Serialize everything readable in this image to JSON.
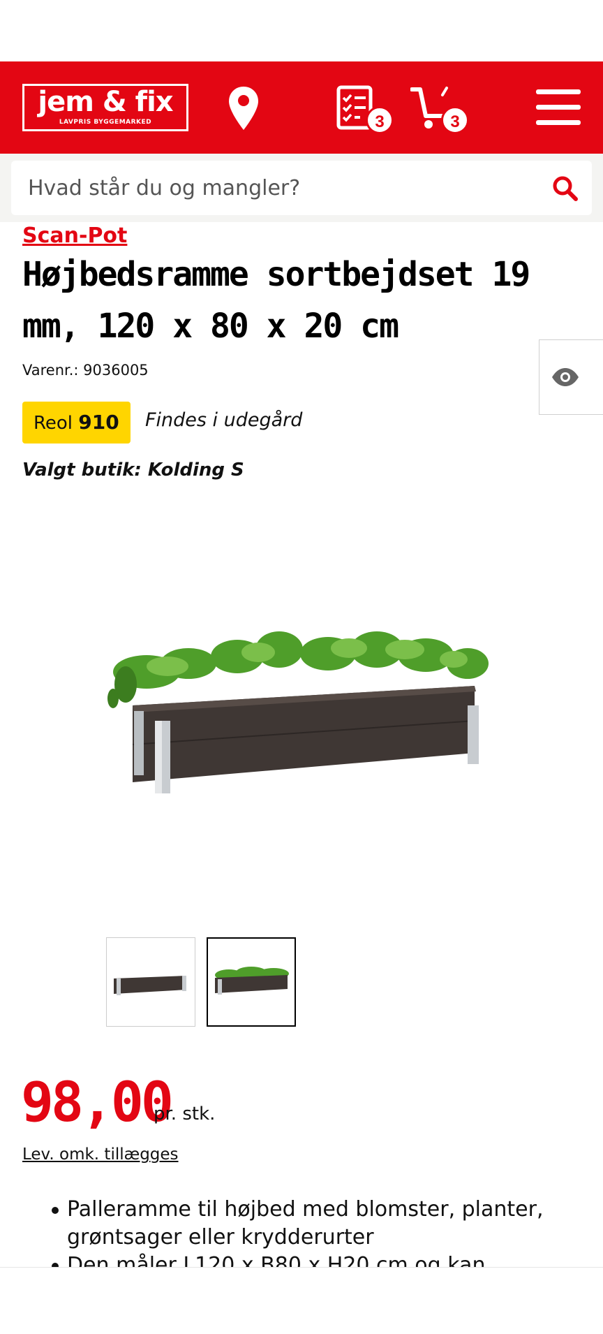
{
  "header": {
    "logo_main": "jem & fix",
    "logo_sub": "LAVPRIS BYGGEMARKED",
    "shopping_list_count": "3",
    "cart_count": "3",
    "brand_color": "#e30613"
  },
  "search": {
    "placeholder": "Hvad står du og mangler?"
  },
  "product": {
    "brand": "Scan-Pot",
    "title": "Højbedsramme sortbejdset 19 mm, 120 x 80 x 20 cm",
    "varenr": "Varenr.: 9036005",
    "reol_label": "Reol",
    "reol_number": "910",
    "location_note": "Findes i udegård",
    "store": "Valgt butik: Kolding S",
    "price": "98,00",
    "price_unit": "pr. stk.",
    "delivery_note": "Lev. omk. tillægges",
    "features": [
      "Palleramme til højbed med blomster, planter, grøntsager eller krydderurter",
      "Den måler L120 x B80 x H20 cm og kan"
    ]
  },
  "icons": {
    "location": "location-pin-icon",
    "list": "shopping-list-icon",
    "cart": "cart-icon",
    "menu": "hamburger-menu-icon",
    "search": "search-icon",
    "eye": "eye-icon"
  },
  "colors": {
    "accent": "#e30613",
    "reol_badge": "#ffd500"
  }
}
